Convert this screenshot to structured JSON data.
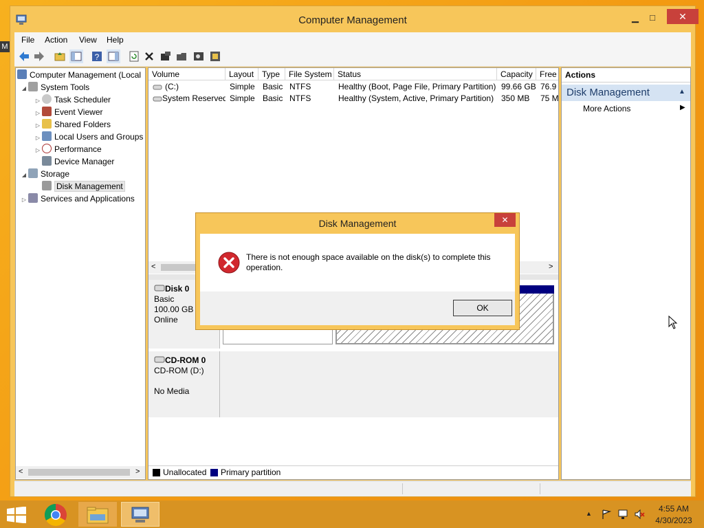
{
  "window": {
    "title": "Computer Management",
    "minimize": "▁",
    "maximize": "□",
    "close": "✕"
  },
  "desktop": {
    "left_glyph": "M"
  },
  "menu": [
    "File",
    "Action",
    "View",
    "Help"
  ],
  "toolbar_icons": [
    "back-icon",
    "forward-icon",
    "up-folder-icon",
    "show-hide-tree-icon",
    "help-icon",
    "properties-icon",
    "refresh-icon",
    "delete-icon",
    "connect-icon",
    "open-icon",
    "search-icon",
    "rescan-icon"
  ],
  "tree": {
    "root": "Computer Management (Local",
    "system_tools": "System Tools",
    "task_scheduler": "Task Scheduler",
    "event_viewer": "Event Viewer",
    "shared_folders": "Shared Folders",
    "local_users": "Local Users and Groups",
    "performance": "Performance",
    "device_manager": "Device Manager",
    "storage": "Storage",
    "disk_management": "Disk Management",
    "services": "Services and Applications"
  },
  "volumes": {
    "headers": [
      "Volume",
      "Layout",
      "Type",
      "File System",
      "Status",
      "Capacity",
      "Free"
    ],
    "rows": [
      [
        "(C:)",
        "Simple",
        "Basic",
        "NTFS",
        "Healthy (Boot, Page File, Primary Partition)",
        "99.66 GB",
        "76.9"
      ],
      [
        "System Reserved",
        "Simple",
        "Basic",
        "NTFS",
        "Healthy (System, Active, Primary Partition)",
        "350 MB",
        "75 M"
      ]
    ]
  },
  "disks": {
    "disk0": {
      "name": "Disk 0",
      "type": "Basic",
      "size": "100.00 GB",
      "status": "Online"
    },
    "cdrom0": {
      "name": "CD-ROM 0",
      "type": "CD-ROM (D:)",
      "status": "No Media"
    }
  },
  "legend": {
    "unallocated": "Unallocated",
    "primary": "Primary partition"
  },
  "actions": {
    "header": "Actions",
    "section": "Disk Management",
    "more": "More Actions"
  },
  "dialog": {
    "title": "Disk Management",
    "close": "✕",
    "message": "There is not enough space available on the disk(s) to complete this operation.",
    "ok": "OK"
  },
  "taskbar": {
    "time": "4:55 AM",
    "date": "4/30/2023"
  },
  "colors": {
    "accent": "#f7c65a",
    "error": "#d1282e",
    "primary_partition": "#000080",
    "taskbar": "#d89322"
  }
}
